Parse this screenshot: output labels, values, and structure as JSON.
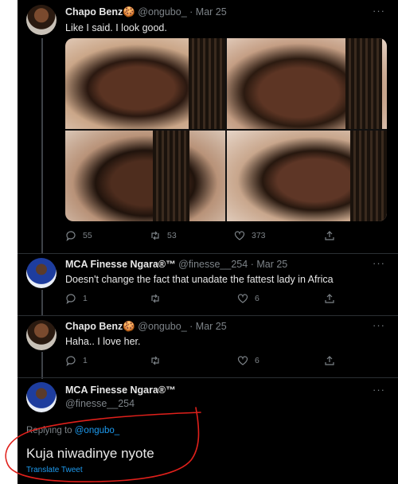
{
  "tweets": [
    {
      "name": "Chapo Benz",
      "emoji": "🍪",
      "handle": "@ongubo_",
      "date": "Mar 25",
      "text": "Like I said. I look good.",
      "replies": "55",
      "retweets": "53",
      "likes": "373"
    },
    {
      "name": "MCA Finesse Ngara®™",
      "handle": "@finesse__254",
      "date": "Mar 25",
      "text": "Doesn't change the fact that unadate the fattest lady in Africa",
      "replies": "1",
      "retweets": "",
      "likes": "6"
    },
    {
      "name": "Chapo Benz",
      "emoji": "🍪",
      "handle": "@ongubo_",
      "date": "Mar 25",
      "text": "Haha.. I love her.",
      "replies": "1",
      "retweets": "",
      "likes": "6"
    }
  ],
  "focused": {
    "name": "MCA Finesse Ngara®™",
    "handle": "@finesse__254",
    "replying_prefix": "Replying to",
    "replying_to": "@ongubo_",
    "text": "Kuja niwadinye nyote",
    "translate": "Translate Tweet"
  },
  "icons": {
    "reply": "reply-icon",
    "retweet": "retweet-icon",
    "like": "heart-icon",
    "share": "share-icon",
    "more": "more-icon"
  },
  "colors": {
    "background": "#000000",
    "link": "#1d9bf0",
    "muted": "#7d8388",
    "annotation": "#e0201b"
  }
}
